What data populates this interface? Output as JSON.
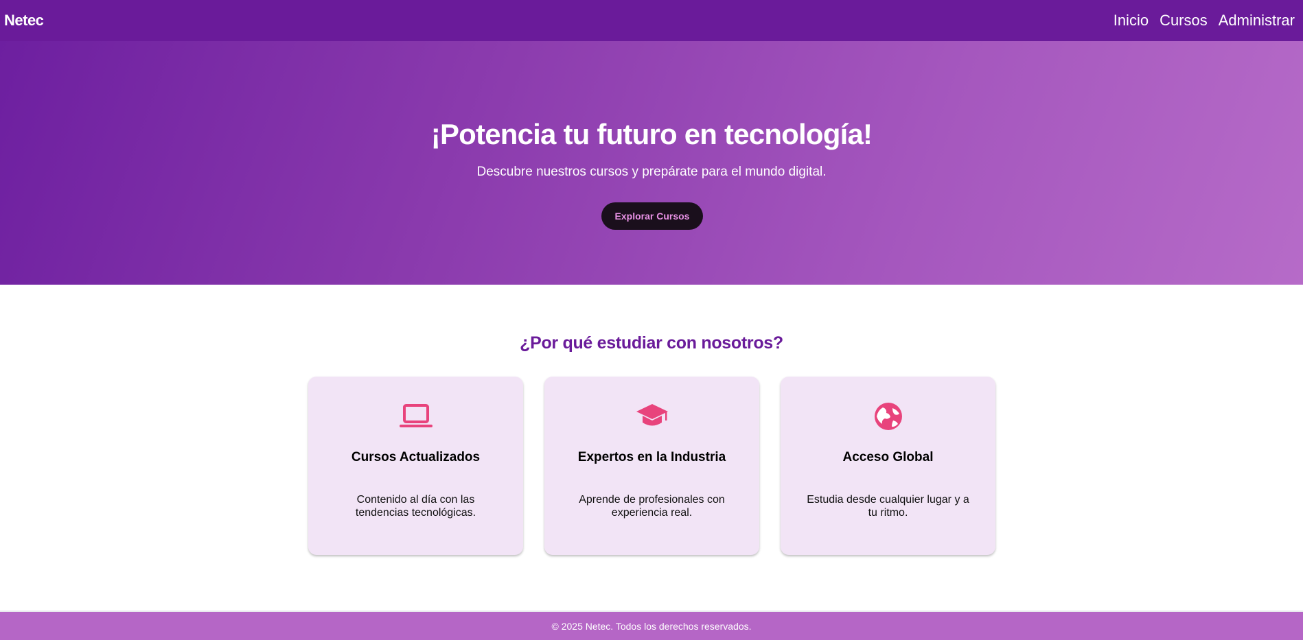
{
  "navbar": {
    "brand": "Netec",
    "links": [
      "Inicio",
      "Cursos",
      "Administrar"
    ]
  },
  "hero": {
    "title": "¡Potencia tu futuro en tecnología!",
    "subtitle": "Descubre nuestros cursos y prepárate para el mundo digital.",
    "button_label": "Explorar Cursos"
  },
  "features": {
    "title": "¿Por qué estudiar con nosotros?",
    "cards": [
      {
        "icon": "laptop-icon",
        "title": "Cursos Actualizados",
        "text": "Contenido al día con las tendencias tecnológicas."
      },
      {
        "icon": "graduation-cap-icon",
        "title": "Expertos en la Industria",
        "text": "Aprende de profesionales con experiencia real."
      },
      {
        "icon": "globe-icon",
        "title": "Acceso Global",
        "text": "Estudia desde cualquier lugar y a tu ritmo."
      }
    ]
  },
  "footer": {
    "text": "© 2025 Netec. Todos los derechos reservados."
  },
  "colors": {
    "primary": "#6a1b9a",
    "accent_icon": "#e8437c",
    "card_bg": "#f2e4f6",
    "footer_bg": "#b566c6",
    "button_bg": "#1a0f1c",
    "button_text": "#e992e6"
  }
}
